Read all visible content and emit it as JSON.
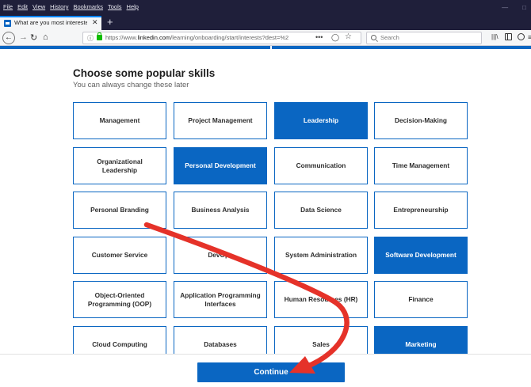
{
  "browser": {
    "menu": [
      "File",
      "Edit",
      "View",
      "History",
      "Bookmarks",
      "Tools",
      "Help"
    ],
    "tab_title": "What are you most interested i",
    "url_prefix": "https://www.",
    "url_domain": "linkedin.com",
    "url_path": "/learning/onboarding/start/interests?dest=%2",
    "search_placeholder": "Search"
  },
  "page": {
    "title": "Choose some popular skills",
    "subtitle": "You can always change these later",
    "skills": [
      {
        "label": "Management",
        "selected": false
      },
      {
        "label": "Project Management",
        "selected": false
      },
      {
        "label": "Leadership",
        "selected": true
      },
      {
        "label": "Decision-Making",
        "selected": false
      },
      {
        "label": "Organizational Leadership",
        "selected": false
      },
      {
        "label": "Personal Development",
        "selected": true
      },
      {
        "label": "Communication",
        "selected": false
      },
      {
        "label": "Time Management",
        "selected": false
      },
      {
        "label": "Personal Branding",
        "selected": false
      },
      {
        "label": "Business Analysis",
        "selected": false
      },
      {
        "label": "Data Science",
        "selected": false
      },
      {
        "label": "Entrepreneurship",
        "selected": false
      },
      {
        "label": "Customer Service",
        "selected": false
      },
      {
        "label": "DevOps",
        "selected": false
      },
      {
        "label": "System Administration",
        "selected": false
      },
      {
        "label": "Software Development",
        "selected": true
      },
      {
        "label": "Object-Oriented Programming (OOP)",
        "selected": false
      },
      {
        "label": "Application Programming Interfaces",
        "selected": false
      },
      {
        "label": "Human Resources (HR)",
        "selected": false
      },
      {
        "label": "Finance",
        "selected": false
      },
      {
        "label": "Cloud Computing",
        "selected": false
      },
      {
        "label": "Databases",
        "selected": false
      },
      {
        "label": "Sales",
        "selected": false
      },
      {
        "label": "Marketing",
        "selected": true
      }
    ],
    "continue_label": "Continue"
  },
  "colors": {
    "accent": "#0a66c2",
    "annotation_arrow": "#e53229"
  }
}
